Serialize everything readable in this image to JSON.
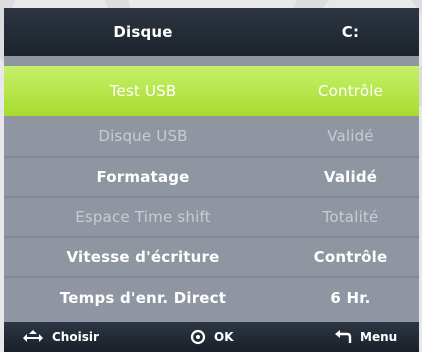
{
  "header": {
    "col1": "Disque",
    "col2": "C:"
  },
  "rows": [
    {
      "label": "Test USB",
      "value": "Contrôle"
    },
    {
      "label": "Disque USB",
      "value": "Validé"
    },
    {
      "label": "Formatage",
      "value": "Validé"
    },
    {
      "label": "Espace Time shift",
      "value": "Totalité"
    },
    {
      "label": "Vitesse d'écriture",
      "value": "Contrôle"
    },
    {
      "label": "Temps d'enr. Direct",
      "value": "6 Hr."
    }
  ],
  "footer": {
    "choose": "Choisir",
    "ok": "OK",
    "menu": "Menu"
  },
  "colors": {
    "highlight": "#b4e445",
    "panel": "#8f96a2",
    "header": "#242c36"
  },
  "icons": [
    "navigate-arrows-icon",
    "ok-circle-icon",
    "return-arrow-icon"
  ]
}
